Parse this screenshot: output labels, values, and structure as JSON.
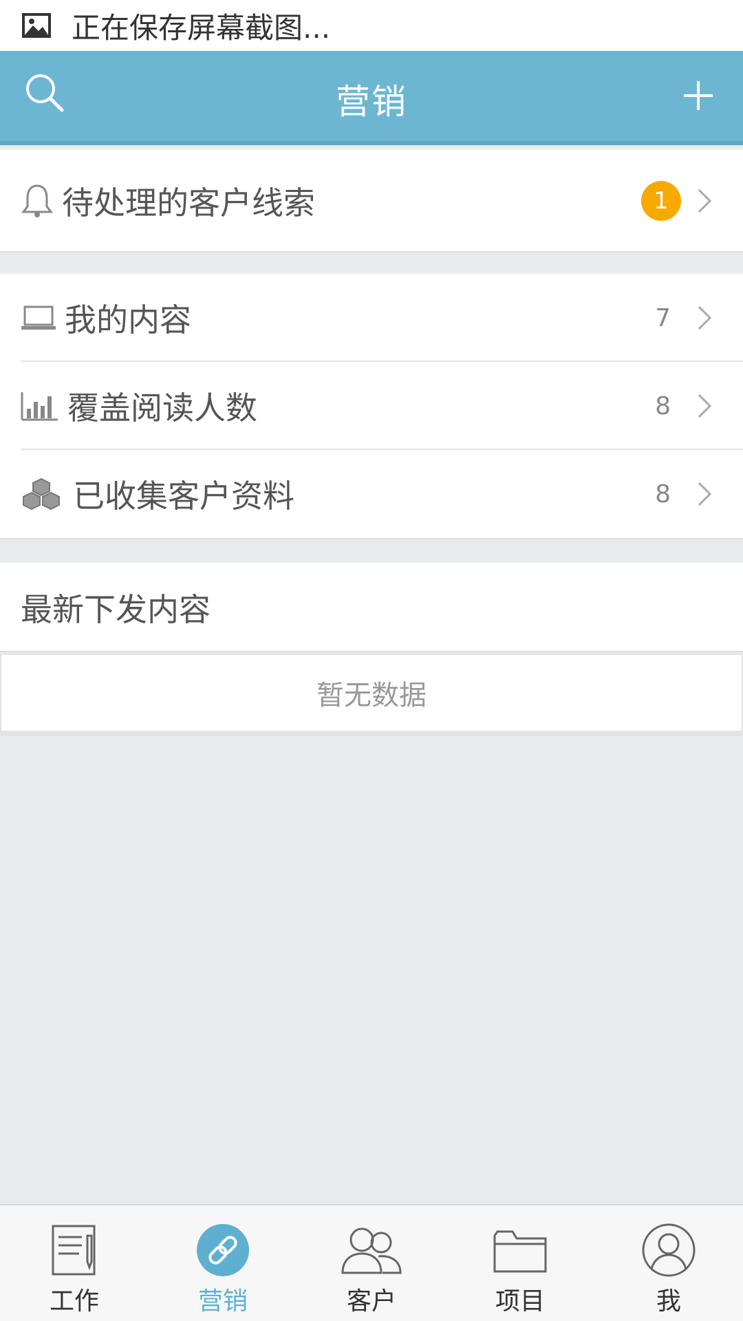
{
  "status_bar": {
    "text": "正在保存屏幕截图..."
  },
  "header": {
    "title": "营销"
  },
  "leads": {
    "label": "待处理的客户线索",
    "badge": "1"
  },
  "stats": [
    {
      "label": "我的内容",
      "count": "7",
      "icon": "laptop-icon"
    },
    {
      "label": "覆盖阅读人数",
      "count": "8",
      "icon": "bar-chart-icon"
    },
    {
      "label": "已收集客户资料",
      "count": "8",
      "icon": "cubes-icon"
    }
  ],
  "latest": {
    "title": "最新下发内容",
    "empty_text": "暂无数据"
  },
  "tabs": [
    {
      "label": "工作",
      "icon": "document-icon",
      "active": false
    },
    {
      "label": "营销",
      "icon": "link-icon",
      "active": true
    },
    {
      "label": "客户",
      "icon": "users-icon",
      "active": false
    },
    {
      "label": "项目",
      "icon": "folder-icon",
      "active": false
    },
    {
      "label": "我",
      "icon": "user-icon",
      "active": false
    }
  ],
  "colors": {
    "header": "#6db6d2",
    "accent": "#5fb0d0",
    "badge": "#f8a900",
    "background": "#e8ebee"
  }
}
